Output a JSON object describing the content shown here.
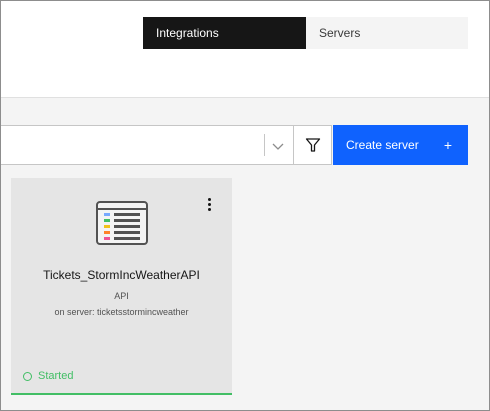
{
  "switcher": {
    "tabs": [
      {
        "label": "Integrations",
        "active": true
      },
      {
        "label": "Servers",
        "active": false
      }
    ]
  },
  "toolbar": {
    "search_value": "",
    "create_label": "Create server",
    "create_icon": "+"
  },
  "cards": [
    {
      "title": "Tickets_StormIncWeatherAPI",
      "type": "API",
      "server": "on server: ticketsstormincweather",
      "status": "Started",
      "icon": "api-icon"
    }
  ],
  "colors": {
    "accent": "#0f62fe",
    "status_started": "#42be65",
    "active_tab_bg": "#161616"
  }
}
